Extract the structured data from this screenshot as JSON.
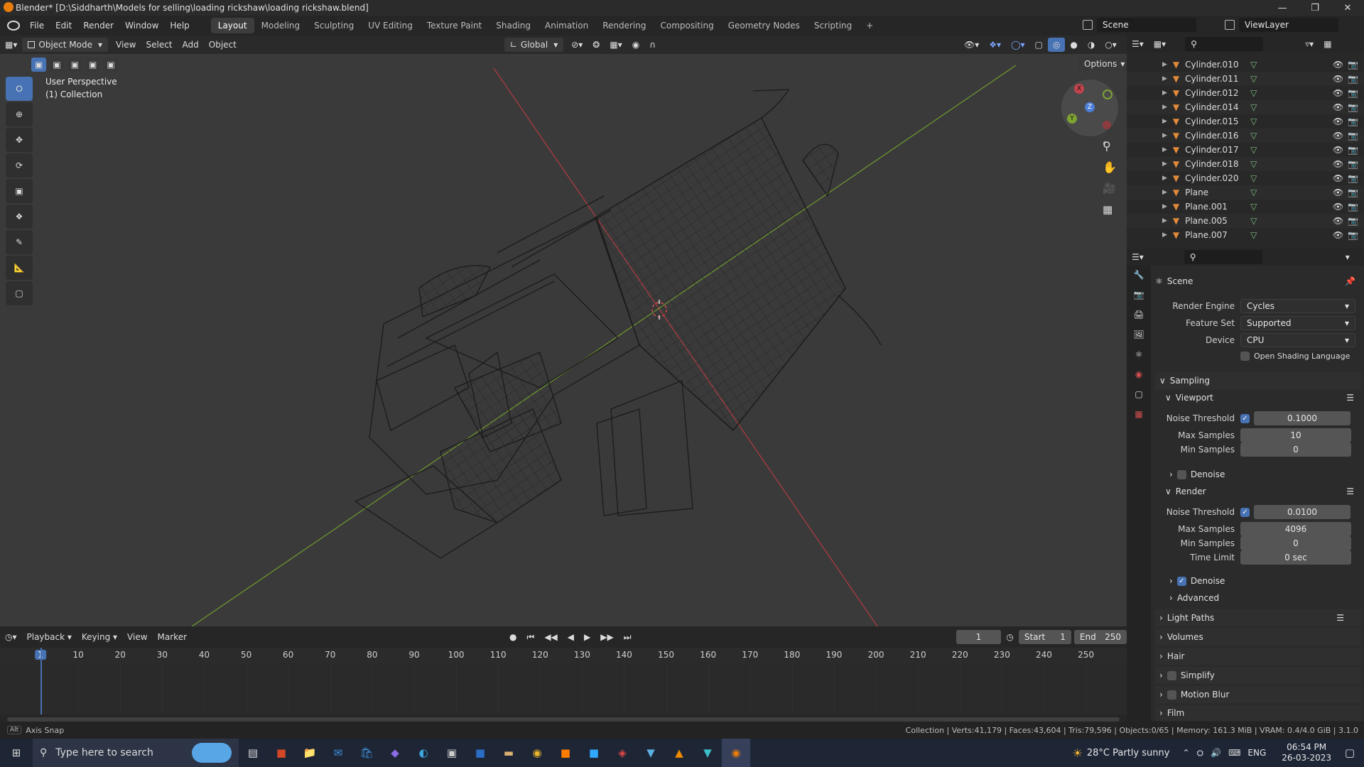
{
  "window": {
    "title": "Blender* [D:\\Siddharth\\Models for selling\\loading rickshaw\\loading rickshaw.blend]"
  },
  "menubar": {
    "menus": [
      "File",
      "Edit",
      "Render",
      "Window",
      "Help"
    ],
    "workspaces": [
      "Layout",
      "Modeling",
      "Sculpting",
      "UV Editing",
      "Texture Paint",
      "Shading",
      "Animation",
      "Rendering",
      "Compositing",
      "Geometry Nodes",
      "Scripting",
      "+"
    ],
    "active_workspace": "Layout",
    "scene_name": "Scene",
    "view_layer": "ViewLayer"
  },
  "viewport_header": {
    "mode": "Object Mode",
    "menus": [
      "View",
      "Select",
      "Add",
      "Object"
    ],
    "orientation": "Global",
    "options_label": "Options"
  },
  "viewport": {
    "perspective_label": "User Perspective",
    "collection_label": "(1) Collection",
    "gizmo_axes": [
      "X",
      "Y",
      "Z"
    ]
  },
  "outliner": {
    "items": [
      "Cylinder.010",
      "Cylinder.011",
      "Cylinder.012",
      "Cylinder.014",
      "Cylinder.015",
      "Cylinder.016",
      "Cylinder.017",
      "Cylinder.018",
      "Cylinder.020",
      "Plane",
      "Plane.001",
      "Plane.005",
      "Plane.007"
    ]
  },
  "properties": {
    "context": "Scene",
    "render_engine_label": "Render Engine",
    "render_engine": "Cycles",
    "feature_set_label": "Feature Set",
    "feature_set": "Supported",
    "device_label": "Device",
    "device": "CPU",
    "osl_label": "Open Shading Language",
    "sampling_label": "Sampling",
    "viewport_label": "Viewport",
    "render_label": "Render",
    "noise_threshold_label": "Noise Threshold",
    "max_samples_label": "Max Samples",
    "min_samples_label": "Min Samples",
    "time_limit_label": "Time Limit",
    "denoise_label": "Denoise",
    "advanced_label": "Advanced",
    "viewport_noise_threshold": "0.1000",
    "viewport_max_samples": "10",
    "viewport_min_samples": "0",
    "render_noise_threshold": "0.0100",
    "render_max_samples": "4096",
    "render_min_samples": "0",
    "render_time_limit": "0 sec",
    "panels": [
      "Light Paths",
      "Volumes",
      "Hair",
      "Simplify",
      "Motion Blur",
      "Film"
    ]
  },
  "timeline": {
    "menus": [
      "Playback",
      "Keying",
      "View",
      "Marker"
    ],
    "current_frame": "1",
    "start_label": "Start",
    "start": "1",
    "end_label": "End",
    "end": "250",
    "ticks": [
      "1",
      "10",
      "20",
      "30",
      "40",
      "50",
      "60",
      "70",
      "80",
      "90",
      "100",
      "110",
      "120",
      "130",
      "140",
      "150",
      "160",
      "170",
      "180",
      "190",
      "200",
      "210",
      "220",
      "230",
      "240",
      "250"
    ]
  },
  "statusbar": {
    "left_key": "Alt",
    "left": "Axis Snap",
    "right": "Collection | Verts:41,179 | Faces:43,604 | Tris:79,596 | Objects:0/65 | Memory: 161.3 MiB | VRAM: 0.4/4.0 GiB | 3.1.0"
  },
  "taskbar": {
    "search_placeholder": "Type here to search",
    "weather": "28°C  Partly sunny",
    "lang": "ENG",
    "time": "06:54 PM",
    "date": "26-03-2023"
  },
  "colors": {
    "accent": "#4772b3",
    "x_axis": "#c2434b",
    "y_axis": "#7ea333",
    "z_axis": "#4c7fd8"
  }
}
